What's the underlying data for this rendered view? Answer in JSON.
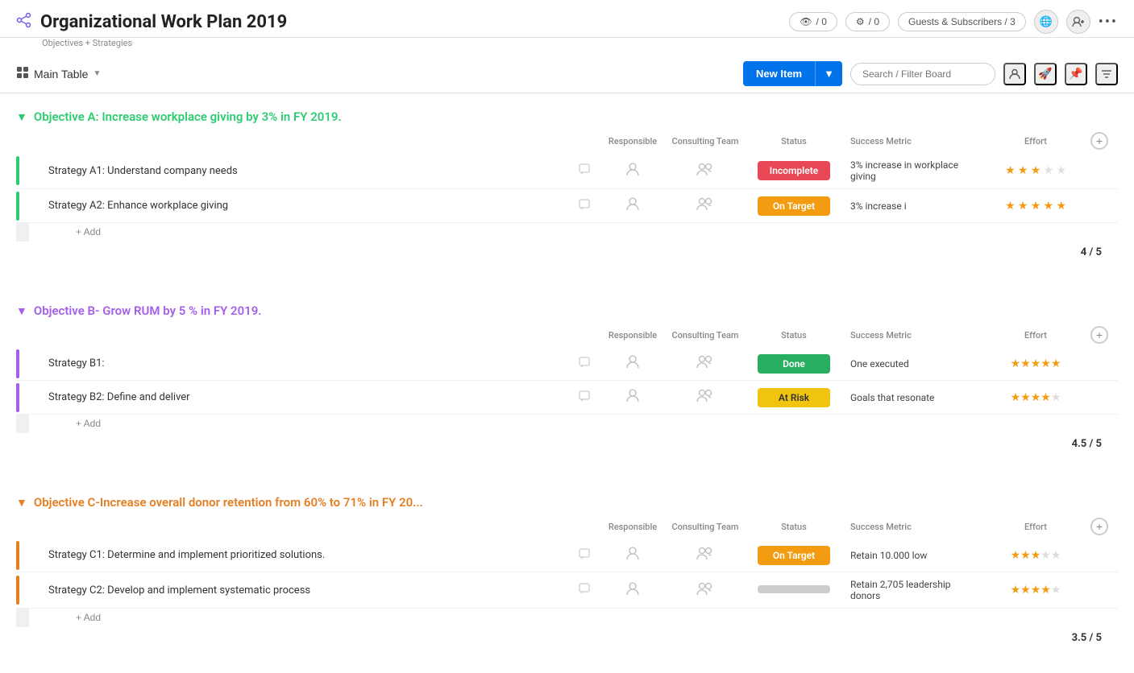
{
  "app": {
    "title": "Organizational Work Plan 2019",
    "subtitle": "Objectives + Strategies",
    "share_count": "0",
    "notify_count": "0",
    "guests_label": "Guests & Subscribers / 3"
  },
  "toolbar": {
    "main_table_label": "Main Table",
    "new_item_label": "New Item",
    "search_placeholder": "Search / Filter Board"
  },
  "objectives": [
    {
      "id": "a",
      "title": "Objective A: Increase workplace giving by 3% in FY 2019.",
      "color_class": "obj-a",
      "bar_class": "bar-green",
      "score": "4 / 5",
      "columns": {
        "responsible": "Responsible",
        "consulting": "Consulting Team",
        "status": "Status",
        "metric": "Success Metric",
        "effort": "Effort"
      },
      "strategies": [
        {
          "name": "Strategy A1: Understand company needs",
          "status": "Incomplete",
          "status_class": "status-incomplete",
          "metric": "3% increase in workplace giving",
          "stars": 3
        },
        {
          "name": "Strategy A2: Enhance workplace giving",
          "status": "On Target",
          "status_class": "status-ontarget",
          "metric": "3% increase i",
          "stars": 5
        }
      ]
    },
    {
      "id": "b",
      "title": "Objective B- Grow RUM by 5 % in FY 2019.",
      "color_class": "obj-b",
      "bar_class": "bar-purple",
      "score": "4.5 / 5",
      "columns": {
        "responsible": "Responsible",
        "consulting": "Consulting Team",
        "status": "Status",
        "metric": "Success Metric",
        "effort": "Effort"
      },
      "strategies": [
        {
          "name": "Strategy B1:",
          "status": "Done",
          "status_class": "status-done",
          "metric": "One executed",
          "stars": 5
        },
        {
          "name": "Strategy B2: Define and deliver",
          "status": "At Risk",
          "status_class": "status-atrisk",
          "metric": "Goals that resonate",
          "stars": 4
        }
      ]
    },
    {
      "id": "c",
      "title": "Objective C-Increase overall donor retention from 60% to 71% in FY 20...",
      "color_class": "obj-c",
      "bar_class": "bar-orange",
      "score": "3.5 / 5",
      "columns": {
        "responsible": "Responsible",
        "consulting": "Consulting Team",
        "status": "Status",
        "metric": "Success Metric",
        "effort": "Effort"
      },
      "strategies": [
        {
          "name": "Strategy C1: Determine and implement prioritized solutions.",
          "status": "On Target",
          "status_class": "status-ontarget",
          "metric": "Retain 10.000 low",
          "stars": 3
        },
        {
          "name": "Strategy C2: Develop and implement systematic process",
          "status": "",
          "status_class": "status-gray",
          "metric": "Retain 2,705 leadership donors",
          "stars": 4
        }
      ]
    }
  ],
  "icons": {
    "share": "⤢",
    "chevron_down": "▼",
    "grid": "⊞",
    "search": "🔍",
    "person": "👤",
    "team": "👥",
    "comment": "💬",
    "plus": "+",
    "more": "•••",
    "star_filled": "★",
    "star_empty": "☆",
    "eye": "👁",
    "pin": "📌",
    "filter": "≡",
    "automation": "⚙",
    "globe": "🌐"
  }
}
